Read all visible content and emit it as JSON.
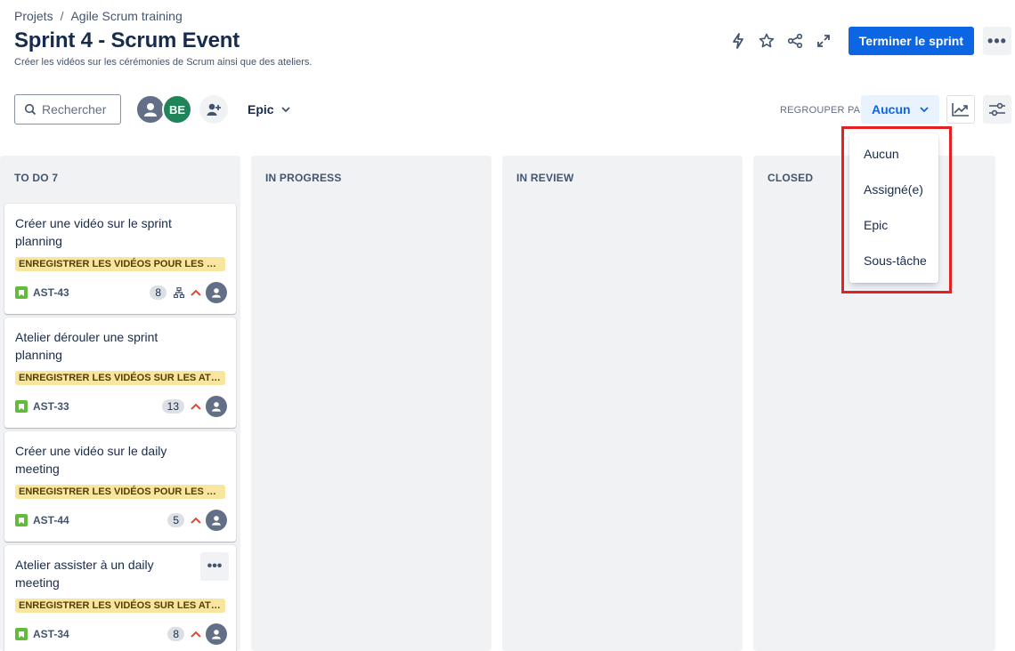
{
  "breadcrumb": {
    "projects": "Projets",
    "separator": "/",
    "project": "Agile Scrum training"
  },
  "page": {
    "title": "Sprint 4 - Scrum Event",
    "subtitle": "Créer les vidéos sur les cérémonies de Scrum ainsi que des ateliers."
  },
  "header": {
    "complete_sprint_label": "Terminer le sprint",
    "more_label": "•••"
  },
  "toolbar": {
    "search_placeholder": "Rechercher",
    "assignee_initials": "BE",
    "epic_filter_label": "Epic",
    "group_by_label": "REGROUPER PAR",
    "group_by_value": "Aucun"
  },
  "group_by_menu": {
    "options": [
      "Aucun",
      "Assigné(e)",
      "Epic",
      "Sous-tâche"
    ]
  },
  "columns": [
    {
      "title": "TO DO 7"
    },
    {
      "title": "IN PROGRESS"
    },
    {
      "title": "IN REVIEW"
    },
    {
      "title": "CLOSED"
    }
  ],
  "cards": [
    {
      "title": "Créer une vidéo sur le sprint planning",
      "epic": "ENREGISTRER LES VIDÉOS POUR LES CÉRÉMONIES",
      "key": "AST-43",
      "points": "8",
      "has_subtasks": true
    },
    {
      "title": "Atelier dérouler une sprint planning",
      "epic": "ENREGISTRER LES VIDÉOS SUR LES ATELIERS",
      "key": "AST-33",
      "points": "13",
      "has_subtasks": false
    },
    {
      "title": "Créer une vidéo sur le daily meeting",
      "epic": "ENREGISTRER LES VIDÉOS POUR LES CÉRÉMONIES",
      "key": "AST-44",
      "points": "5",
      "has_subtasks": false
    },
    {
      "title": "Atelier assister à un daily meeting",
      "epic": "ENREGISTRER LES VIDÉOS SUR LES ATELIERS",
      "key": "AST-34",
      "points": "8",
      "has_subtasks": false,
      "card_more_label": "•••"
    }
  ],
  "colors": {
    "primary": "#0c66e4",
    "epic_bg": "#f8e6a0",
    "epic_text": "#533f04",
    "story": "#63ba3c",
    "priority_high": "#e34935",
    "highlight": "#e52020"
  },
  "icons": [
    "lightning-icon",
    "star-icon",
    "share-icon",
    "expand-icon",
    "search-icon",
    "person-icon",
    "add-person-icon",
    "chevron-down-icon",
    "chart-icon",
    "settings-sliders-icon",
    "story-icon",
    "subtask-icon",
    "priority-high-icon"
  ]
}
